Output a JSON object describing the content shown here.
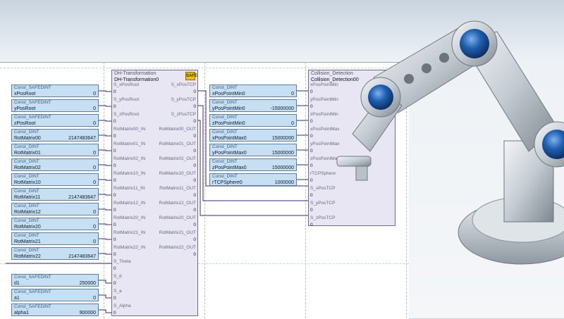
{
  "constants_left": [
    {
      "type": "Const_SAFEDINT",
      "name": "xPosRoot",
      "value": "0"
    },
    {
      "type": "Const_SAFEDINT",
      "name": "yPosRoot",
      "value": "0"
    },
    {
      "type": "Const_SAFEDINT",
      "name": "zPosRoot",
      "value": "0"
    },
    {
      "type": "Const_DINT",
      "name": "RotMatrix00",
      "value": "2147483647"
    },
    {
      "type": "Const_DINT",
      "name": "RotMatrix01",
      "value": "0"
    },
    {
      "type": "Const_DINT",
      "name": "RotMatrix02",
      "value": "0"
    },
    {
      "type": "Const_DINT",
      "name": "RotMatrix10",
      "value": "0"
    },
    {
      "type": "Const_DINT",
      "name": "RotMatrix11",
      "value": "2147483647"
    },
    {
      "type": "Const_DINT",
      "name": "RotMatrix12",
      "value": "0"
    },
    {
      "type": "Const_DINT",
      "name": "RotMatrix20",
      "value": "0"
    },
    {
      "type": "Const_DINT",
      "name": "RotMatrix21",
      "value": "0"
    },
    {
      "type": "Const_DINT",
      "name": "RotMatrix22",
      "value": "2147483647"
    }
  ],
  "constants_bottom": [
    {
      "type": "Const_SAFEDINT",
      "name": "d1",
      "value": "250000"
    },
    {
      "type": "Const_SAFEDINT",
      "name": "a1",
      "value": "0"
    },
    {
      "type": "Const_SAFEDINT",
      "name": "alpha1",
      "value": "900000"
    }
  ],
  "dh_block": {
    "type": "DH-Transformation",
    "instance": "DH-Transformation0",
    "badge": "SAFE",
    "inputs": [
      {
        "name": "S_xPosRoot",
        "value": "0"
      },
      {
        "name": "S_yPosRoot",
        "value": "0"
      },
      {
        "name": "S_zPosRoot",
        "value": "0"
      },
      {
        "name": "RotMatrix00_IN",
        "value": "0"
      },
      {
        "name": "RotMatrix01_IN",
        "value": "0"
      },
      {
        "name": "RotMatrix02_IN",
        "value": "0"
      },
      {
        "name": "RotMatrix10_IN",
        "value": "0"
      },
      {
        "name": "RotMatrix11_IN",
        "value": "0"
      },
      {
        "name": "RotMatrix12_IN",
        "value": "0"
      },
      {
        "name": "RotMatrix20_IN",
        "value": "0"
      },
      {
        "name": "RotMatrix21_IN",
        "value": "0"
      },
      {
        "name": "RotMatrix22_IN",
        "value": "0"
      },
      {
        "name": "S_Theta",
        "value": "0"
      },
      {
        "name": "S_d",
        "value": "0"
      },
      {
        "name": "S_a",
        "value": "0"
      },
      {
        "name": "S_Alpha",
        "value": "0"
      }
    ],
    "outputs": [
      {
        "name": "S_xPosTCP",
        "value": "0"
      },
      {
        "name": "S_yPosTCP",
        "value": "0"
      },
      {
        "name": "S_zPosTCP",
        "value": "0"
      },
      {
        "name": "RotMatrix00_OUT",
        "value": "0"
      },
      {
        "name": "RotMatrix01_OUT",
        "value": "0"
      },
      {
        "name": "RotMatrix02_OUT",
        "value": "0"
      },
      {
        "name": "RotMatrix10_OUT",
        "value": "0"
      },
      {
        "name": "RotMatrix11_OUT",
        "value": "0"
      },
      {
        "name": "RotMatrix12_OUT",
        "value": "0"
      },
      {
        "name": "RotMatrix20_OUT",
        "value": "0"
      },
      {
        "name": "RotMatrix21_OUT",
        "value": "0"
      },
      {
        "name": "RotMatrix22_OUT",
        "value": "0"
      }
    ]
  },
  "constants_middle": [
    {
      "type": "Const_DINT",
      "name": "xPosPointMin0",
      "value": "0"
    },
    {
      "type": "Const_DINT",
      "name": "yPosPointMin0",
      "value": "-15000000"
    },
    {
      "type": "Const_DINT",
      "name": "zPosPointMin0",
      "value": "0"
    },
    {
      "type": "Const_DINT",
      "name": "xPosPointMax0",
      "value": "15000000"
    },
    {
      "type": "Const_DINT",
      "name": "yPosPointMax0",
      "value": "15000000"
    },
    {
      "type": "Const_DINT",
      "name": "zPosPointMax0",
      "value": "15000000"
    },
    {
      "type": "Const_DINT",
      "name": "rTCPSphere0",
      "value": "1000000"
    }
  ],
  "collision_block": {
    "type": "Collision_Detection",
    "instance": "Collision_Detection00",
    "inputs": [
      {
        "name": "xPosPointMin",
        "value": "0"
      },
      {
        "name": "yPosPointMin",
        "value": "0"
      },
      {
        "name": "zPosPointMin",
        "value": "0"
      },
      {
        "name": "xPosPointMax",
        "value": "0"
      },
      {
        "name": "yPosPointMax",
        "value": "0"
      },
      {
        "name": "zPosPointMax",
        "value": "0"
      },
      {
        "name": "rTCPSphere",
        "value": "0"
      },
      {
        "name": "S_xPosTCP",
        "value": "0"
      },
      {
        "name": "S_yPosTCP",
        "value": "0"
      },
      {
        "name": "S_zPosTCP",
        "value": "0"
      }
    ]
  },
  "colors": {
    "const_fill": "#c7dff3",
    "fb_fill": "#e8e6f2",
    "wire": "#3b2a78",
    "robot_joint": "#1f5fb0"
  }
}
